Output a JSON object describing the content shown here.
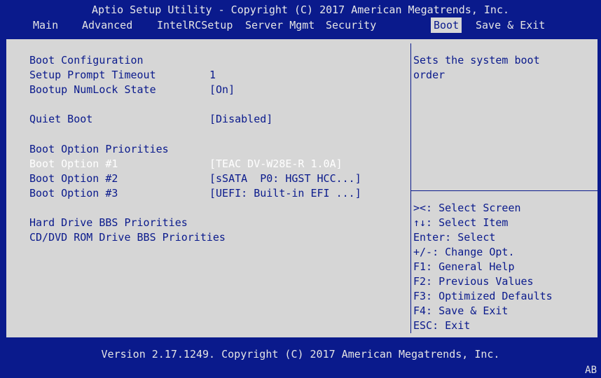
{
  "header": {
    "title": "Aptio Setup Utility - Copyright (C) 2017 American Megatrends, Inc."
  },
  "menu": [
    {
      "label": "Main"
    },
    {
      "label": "Advanced"
    },
    {
      "label": "IntelRCSetup"
    },
    {
      "label": "Server Mgmt"
    },
    {
      "label": "Security"
    },
    {
      "label": "Boot"
    },
    {
      "label": "Save & Exit"
    }
  ],
  "active_menu": "Boot",
  "settings": {
    "section_boot_config": "Boot Configuration",
    "setup_prompt_timeout": {
      "label": "Setup Prompt Timeout",
      "value": "1"
    },
    "bootup_numlock": {
      "label": "Bootup NumLock State",
      "value": "[On]"
    },
    "quiet_boot": {
      "label": "Quiet Boot",
      "value": "[Disabled]"
    },
    "section_boot_priorities": "Boot Option Priorities",
    "boot_option_1": {
      "label": "Boot Option #1",
      "value": "[TEAC DV-W28E-R 1.0A]"
    },
    "boot_option_2": {
      "label": "Boot Option #2",
      "value": "[sSATA  P0: HGST HCC...]"
    },
    "boot_option_3": {
      "label": "Boot Option #3",
      "value": "[UEFI: Built-in EFI ...]"
    },
    "hdd_bbs": "Hard Drive BBS Priorities",
    "cd_bbs": "CD/DVD ROM Drive BBS Priorities"
  },
  "help": {
    "description_line1": "Sets the system boot",
    "description_line2": "order",
    "keys": [
      "><: Select Screen",
      "↑↓: Select Item",
      "Enter: Select",
      "+/-: Change Opt.",
      "F1: General Help",
      "F2: Previous Values",
      "F3: Optimized Defaults",
      "F4: Save & Exit",
      "ESC: Exit"
    ]
  },
  "footer": {
    "version": "Version 2.17.1249. Copyright (C) 2017 American Megatrends, Inc.",
    "corner": "AB"
  },
  "colors": {
    "background_blue": "#0a1a8c",
    "panel_gray": "#d6d6d6",
    "highlight_text": "#ffffff"
  }
}
